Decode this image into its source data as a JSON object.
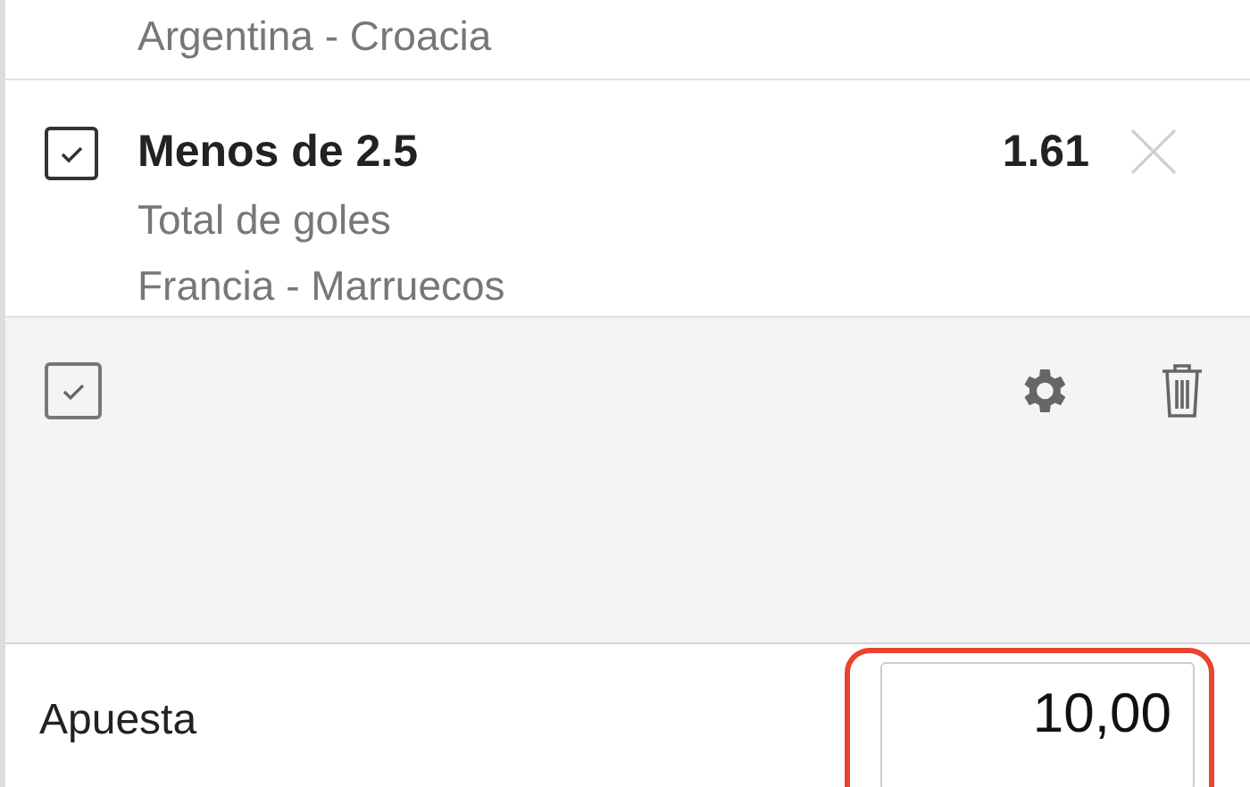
{
  "bets": [
    {
      "kind": "partial",
      "match": "Argentina - Croacia"
    },
    {
      "kind": "full",
      "checked": true,
      "selection": "Menos de 2.5",
      "odds": "1.61",
      "market": "Total de goles",
      "match": "Francia - Marruecos"
    }
  ],
  "toolbar": {
    "select_all_checked": true
  },
  "stake": {
    "label": "Apuesta",
    "value": "10,00",
    "highlighted": true
  }
}
